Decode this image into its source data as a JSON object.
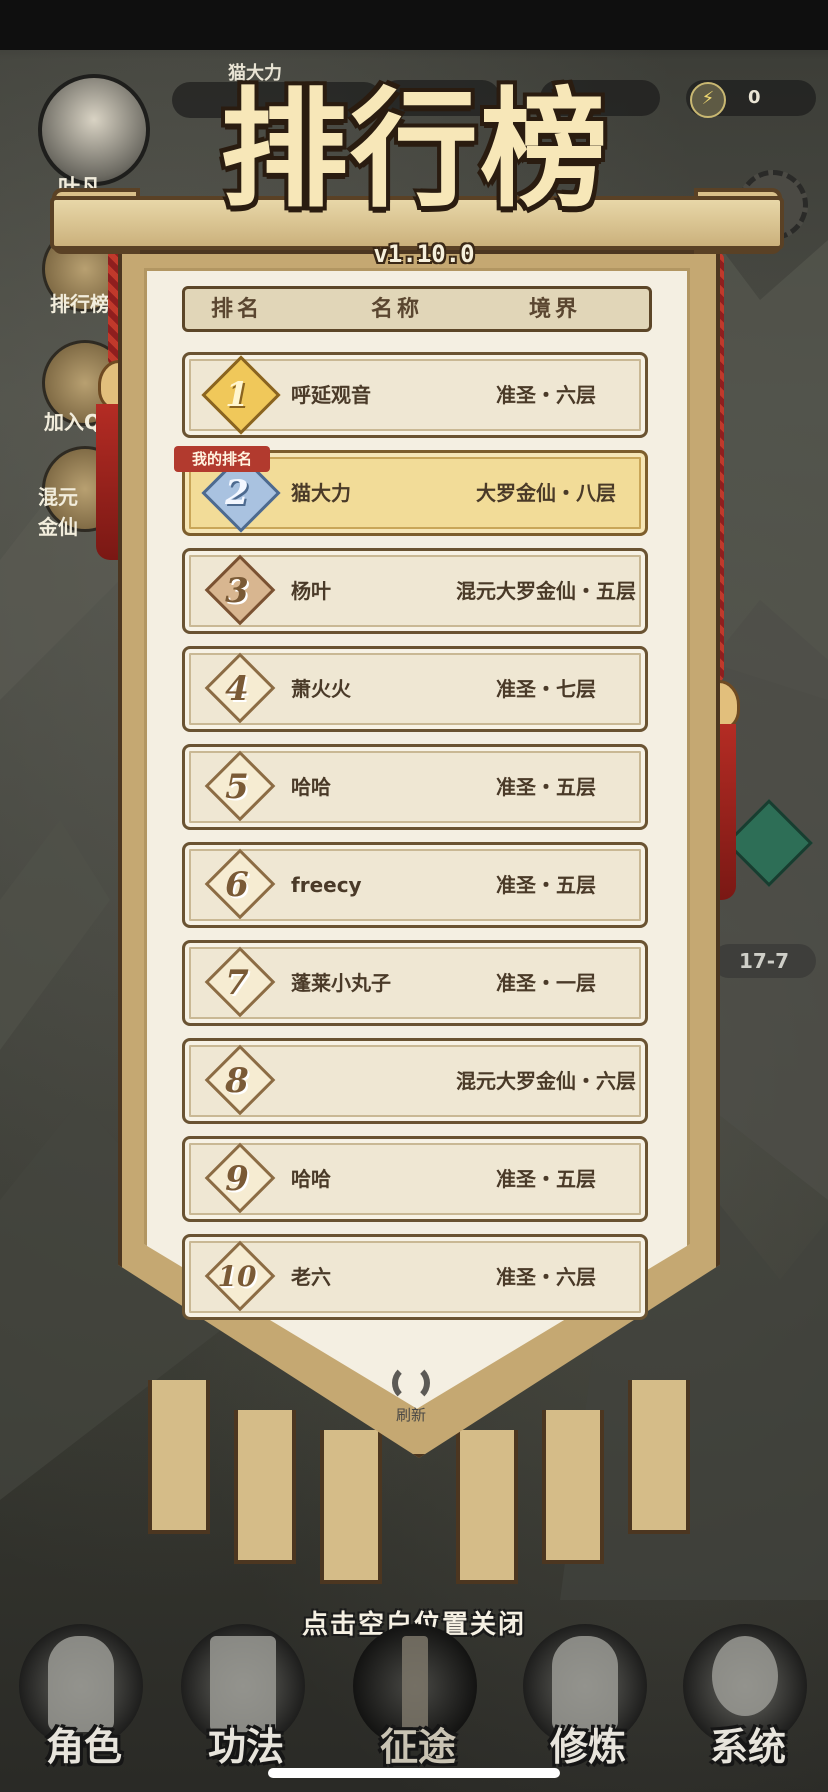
{
  "hud": {
    "player_name": "叶凡",
    "top_label": "猫大力",
    "energy_value": "0",
    "stage_label": "17-7",
    "side_buttons": [
      {
        "label": "排行榜"
      },
      {
        "label": "加入Q"
      },
      {
        "label": "混元金仙"
      }
    ]
  },
  "leaderboard": {
    "title": "排行榜",
    "version": "v1.10.0",
    "headers": {
      "rank": "排名",
      "name": "名称",
      "realm": "境界"
    },
    "my_rank_tag": "我的排名",
    "rows": [
      {
        "rank": "1",
        "name": "呼延观音",
        "realm": "准圣・六层"
      },
      {
        "rank": "2",
        "name": "猫大力",
        "realm": "大罗金仙・八层"
      },
      {
        "rank": "3",
        "name": "杨叶",
        "realm": "混元大罗金仙・五层"
      },
      {
        "rank": "4",
        "name": "萧火火",
        "realm": "准圣・七层"
      },
      {
        "rank": "5",
        "name": "哈哈",
        "realm": "准圣・五层"
      },
      {
        "rank": "6",
        "name": "freecy",
        "realm": "准圣・五层"
      },
      {
        "rank": "7",
        "name": "蓬莱小丸子",
        "realm": "准圣・一层"
      },
      {
        "rank": "8",
        "name": "",
        "realm": "混元大罗金仙・六层"
      },
      {
        "rank": "9",
        "name": "哈哈",
        "realm": "准圣・五层"
      },
      {
        "rank": "10",
        "name": "老六",
        "realm": "准圣・六层"
      }
    ],
    "refresh_label": "刷新",
    "close_hint": "点击空白位置关闭"
  },
  "nav": {
    "items": [
      {
        "label": "角色"
      },
      {
        "label": "功法"
      },
      {
        "label": "征途"
      },
      {
        "label": "修炼"
      },
      {
        "label": "系统"
      }
    ],
    "active_index": 2
  },
  "colors": {
    "banner_gold": "#c5a872",
    "paper": "#f4efe2",
    "row_highlight": "#f2dc98",
    "tag_red": "#b23a2e",
    "tassel_red": "#b42c24"
  }
}
